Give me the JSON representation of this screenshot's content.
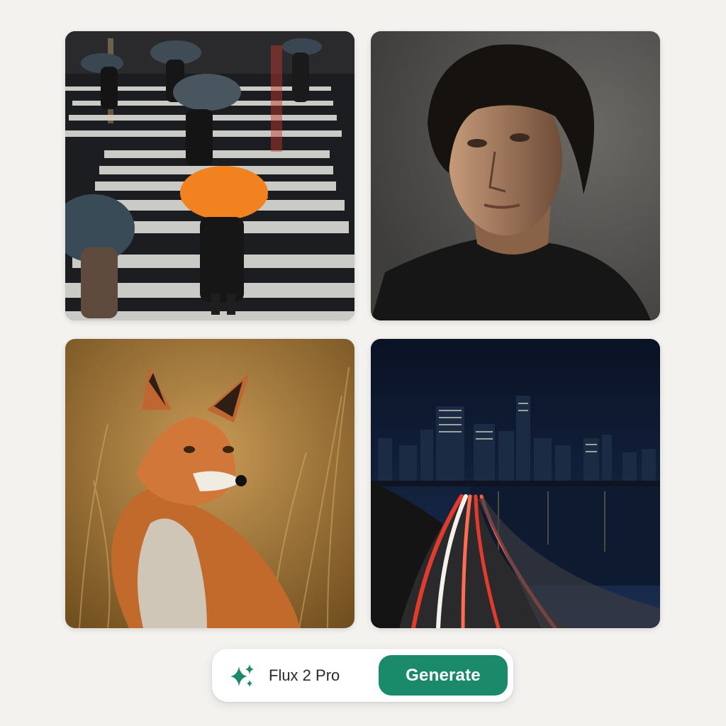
{
  "gallery": {
    "images": [
      {
        "subject": "pedestrians with umbrellas crossing a wet crosswalk at night"
      },
      {
        "subject": "portrait of a dark-haired man in a black sweater"
      },
      {
        "subject": "red fox sitting in golden grass"
      },
      {
        "subject": "city skyline at night with light trails along a waterfront highway"
      }
    ]
  },
  "toolbar": {
    "model_icon": "sparkle-icon",
    "model_label": "Flux 2 Pro",
    "generate_label": "Generate"
  },
  "colors": {
    "accent": "#1b8a6b",
    "background": "#f3f2ef",
    "toolbar_bg": "#ffffff"
  }
}
